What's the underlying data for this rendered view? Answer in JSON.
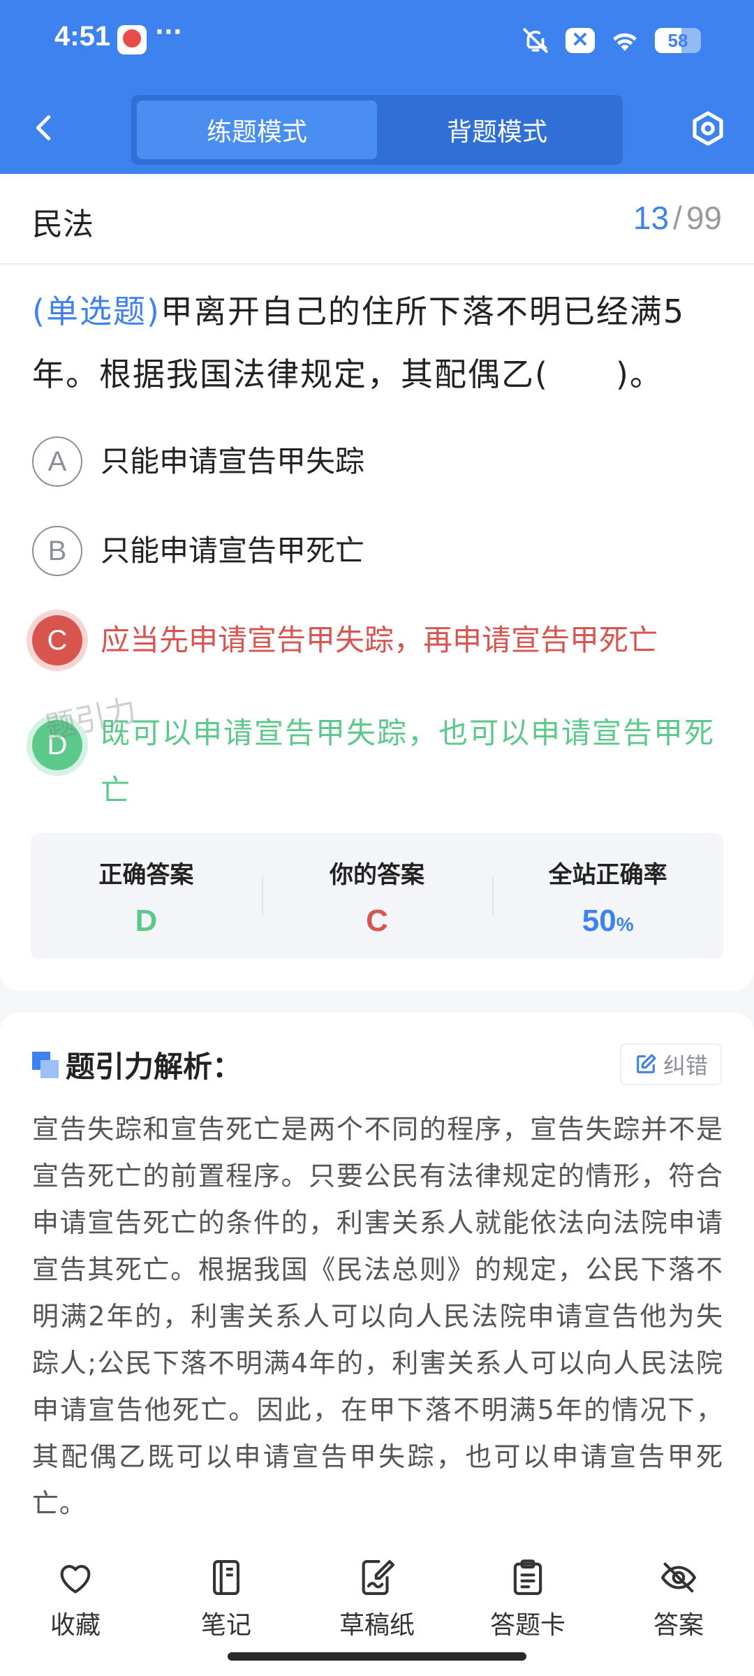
{
  "status_bar": {
    "time": "4:51",
    "dots": "···",
    "battery": "58",
    "battery_level": 0.58
  },
  "header": {
    "tabs": [
      {
        "label": "练题模式",
        "active": true
      },
      {
        "label": "背题模式",
        "active": false
      }
    ]
  },
  "question": {
    "subject": "民法",
    "current": "13",
    "separator": "/",
    "total": "99",
    "type_label": "(单选题)",
    "text": "甲离开自己的住所下落不明已经满5年。根据我国法律规定，其配偶乙(　　)。",
    "options": [
      {
        "letter": "A",
        "text": "只能申请宣告甲失踪",
        "state": "normal"
      },
      {
        "letter": "B",
        "text": "只能申请宣告甲死亡",
        "state": "normal"
      },
      {
        "letter": "C",
        "text": "应当先申请宣告甲失踪，再申请宣告甲死亡",
        "state": "wrong"
      },
      {
        "letter": "D",
        "text": "既可以申请宣告甲失踪，也可以申请宣告甲死亡",
        "state": "correct"
      }
    ]
  },
  "answer_summary": {
    "correct_label": "正确答案",
    "correct_value": "D",
    "mine_label": "你的答案",
    "mine_value": "C",
    "rate_label": "全站正确率",
    "rate_value": "50",
    "rate_unit": "%",
    "watermark": "题引力"
  },
  "analysis": {
    "title": "题引力解析：",
    "report_label": "纠错",
    "text": "宣告失踪和宣告死亡是两个不同的程序，宣告失踪并不是宣告死亡的前置程序。只要公民有法律规定的情形，符合申请宣告死亡的条件的，利害关系人就能依法向法院申请宣告其死亡。根据我国《民法总则》的规定，公民下落不明满2年的，利害关系人可以向人民法院申请宣告他为失踪人;公民下落不明满4年的，利害关系人可以向人民法院申请宣告他死亡。因此，在甲下落不明满5年的情况下，其配偶乙既可以申请宣告甲失踪，也可以申请宣告甲死亡。"
  },
  "bottom_bar": {
    "tabs": [
      {
        "label": "收藏",
        "icon": "heart-icon"
      },
      {
        "label": "笔记",
        "icon": "notebook-icon"
      },
      {
        "label": "草稿纸",
        "icon": "draft-icon"
      },
      {
        "label": "答题卡",
        "icon": "clipboard-icon"
      },
      {
        "label": "答案",
        "icon": "eye-off-icon"
      }
    ]
  },
  "colors": {
    "brand": "#3d82ef",
    "wrong": "#d9534f",
    "correct": "#5cc98a"
  }
}
